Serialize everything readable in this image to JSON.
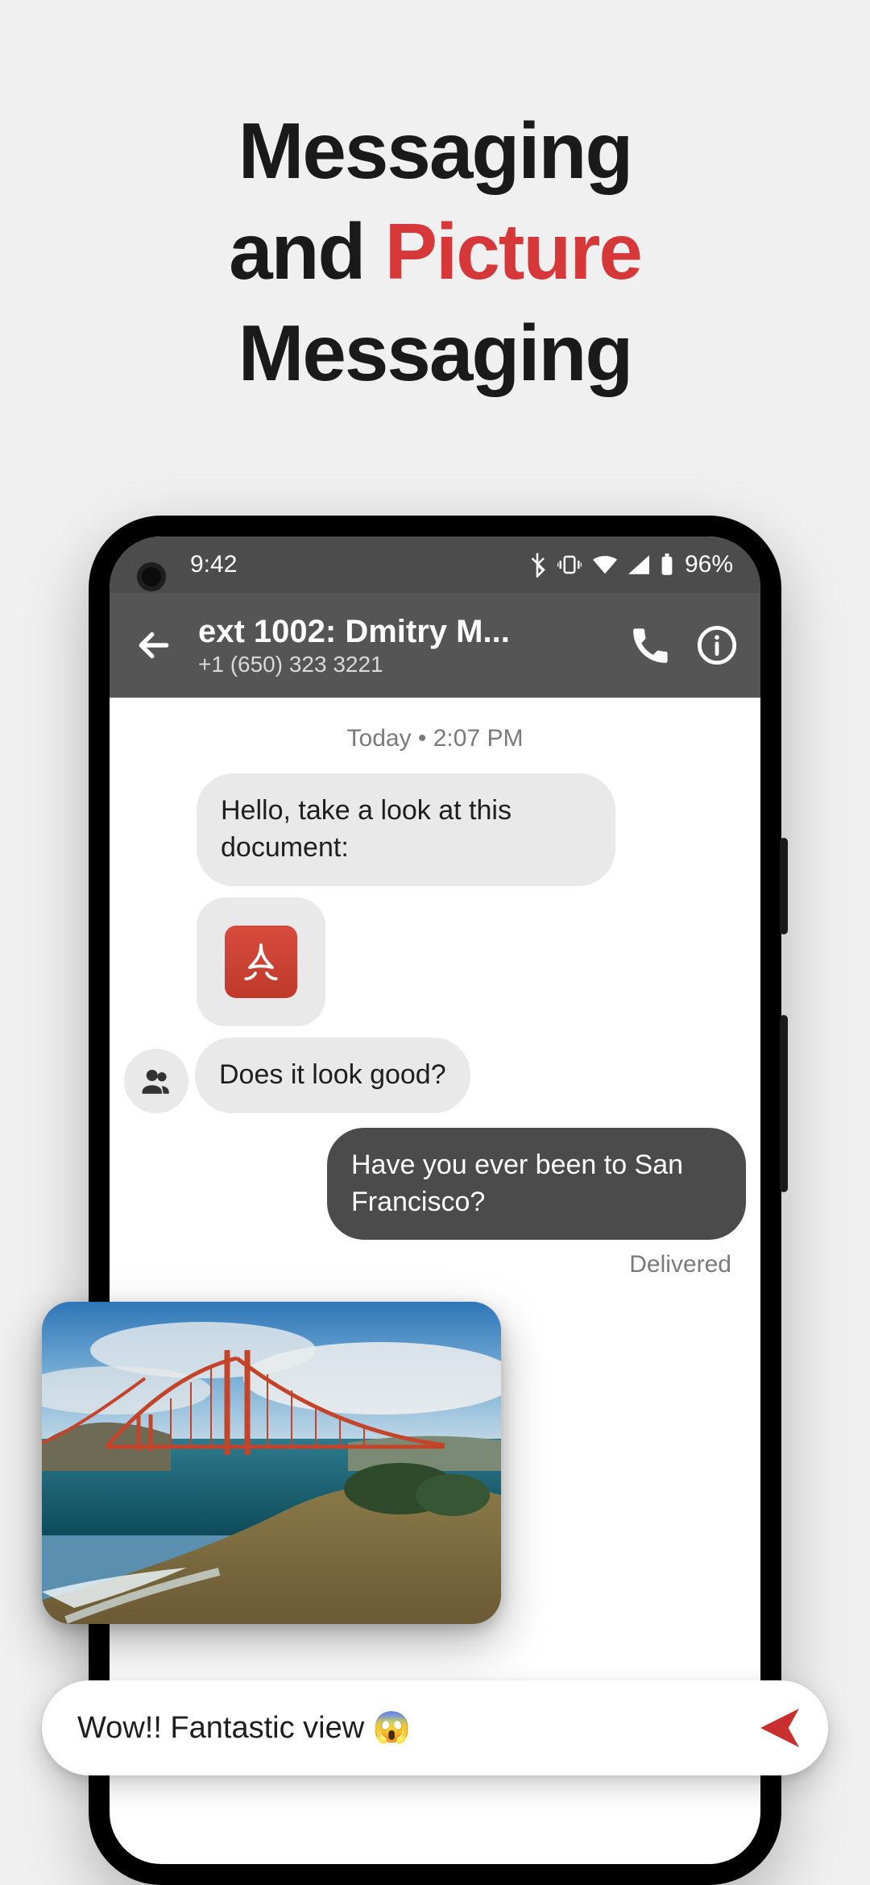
{
  "headline": {
    "line1_a": "Messaging",
    "line2_a": "and ",
    "line2_b": "Picture",
    "line3_a": "Messaging"
  },
  "statusbar": {
    "time": "9:42",
    "battery_pct": "96%"
  },
  "header": {
    "contact_name": "ext 1002: Dmitry M...",
    "contact_number": "+1 (650) 323 3221"
  },
  "chat": {
    "date_line": "Today • 2:07 PM",
    "messages": {
      "m0": "Hello, take a look at this document:",
      "m1_attachment": "pdf-document",
      "m2": "Does it look good?",
      "m3": "Have you ever been to San Francisco?",
      "m3_status": "Delivered"
    }
  },
  "compose": {
    "value": "Wow!! Fantastic view 😱"
  },
  "colors": {
    "accent": "#d6383a",
    "header_bg": "#555555",
    "bubble_out": "#4b4b4b",
    "bubble_in": "#e9e9e9"
  }
}
